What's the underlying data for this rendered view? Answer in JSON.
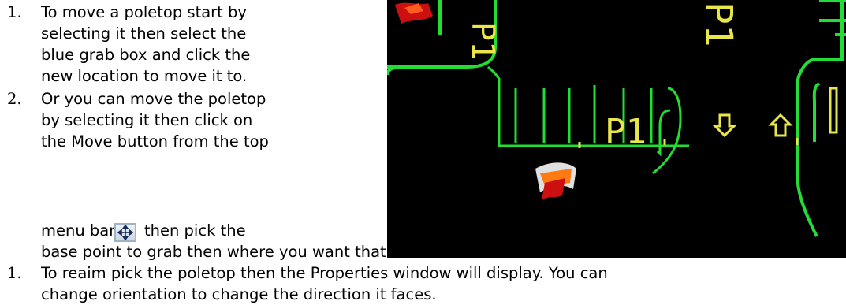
{
  "instructions": {
    "step1": {
      "num": "1.",
      "lines": [
        "To move a poletop start by",
        "selecting it then select the",
        "blue grab box and click the",
        "new location to move it to."
      ]
    },
    "step2": {
      "num": "2.",
      "lines": [
        "Or you can move the poletop",
        "by selecting it then click on",
        "the Move button from the top"
      ],
      "line4_before": "menu bar",
      "line4_after": "then pick the",
      "line5": "base point to grab then where you want that new location."
    },
    "step3": {
      "num": "1.",
      "lines": [
        "To reaim pick the poletop then the Properties window will display.  You can",
        "change orientation to change the direction it faces."
      ]
    }
  },
  "move_button": {
    "icon": "move-arrows-icon"
  },
  "cad_view": {
    "labels": [
      "P1",
      "P1",
      "P1"
    ],
    "colors": {
      "background": "#000000",
      "green": "#22dd33",
      "yellow": "#e8e64a",
      "red": "#cc1010"
    }
  }
}
